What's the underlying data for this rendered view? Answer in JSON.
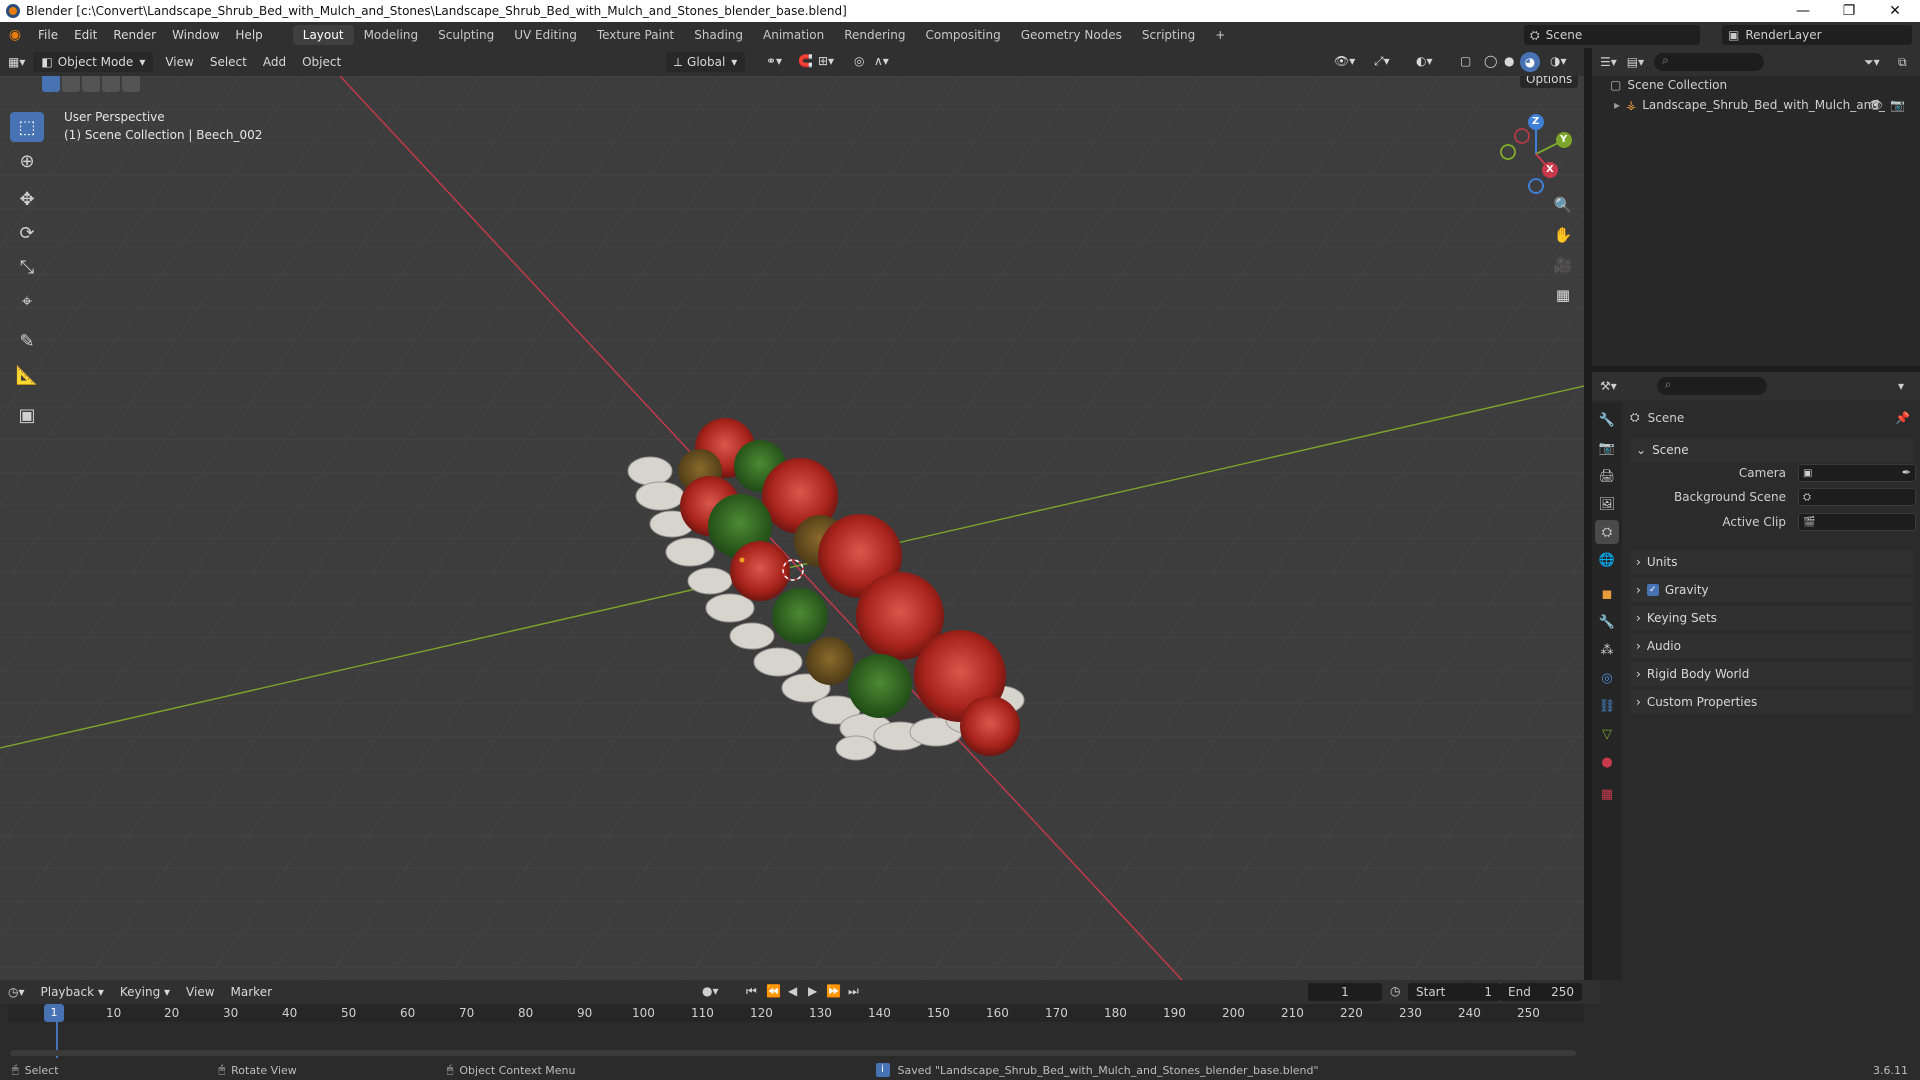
{
  "window": {
    "title": "Blender [c:\\Convert\\Landscape_Shrub_Bed_with_Mulch_and_Stones\\Landscape_Shrub_Bed_with_Mulch_and_Stones_blender_base.blend]",
    "minimize": "—",
    "maximize": "❐",
    "close": "✕"
  },
  "menu": {
    "items": [
      "File",
      "Edit",
      "Render",
      "Window",
      "Help"
    ],
    "workspaces": [
      "Layout",
      "Modeling",
      "Sculpting",
      "UV Editing",
      "Texture Paint",
      "Shading",
      "Animation",
      "Rendering",
      "Compositing",
      "Geometry Nodes",
      "Scripting"
    ],
    "add_tab": "+",
    "scene_name": "Scene",
    "render_layer": "RenderLayer"
  },
  "viewport_header": {
    "mode": "Object Mode",
    "menus": [
      "View",
      "Select",
      "Add",
      "Object"
    ],
    "transform_orientation": "Global",
    "options_label": "Options"
  },
  "viewport": {
    "perspective_label": "User Perspective",
    "collection_label": "(1) Scene Collection | Beech_002",
    "gizmo_axes": {
      "x": "X",
      "y": "Y",
      "z": "Z"
    }
  },
  "outliner": {
    "root": "Scene Collection",
    "object": "Landscape_Shrub_Bed_with_Mulch_and_"
  },
  "properties": {
    "header": "Scene",
    "section": "Scene",
    "fields": {
      "camera_label": "Camera",
      "background_scene_label": "Background Scene",
      "active_clip_label": "Active Clip"
    },
    "panels": [
      "Units",
      "Gravity",
      "Keying Sets",
      "Audio",
      "Rigid Body World",
      "Custom Properties"
    ],
    "gravity_checked": true
  },
  "timeline": {
    "menus": [
      "Playback",
      "Keying",
      "View",
      "Marker"
    ],
    "current_frame": "1",
    "start_label": "Start",
    "start_value": "1",
    "end_label": "End",
    "end_value": "250",
    "ruler": [
      "1",
      "10",
      "20",
      "30",
      "40",
      "50",
      "60",
      "70",
      "80",
      "90",
      "100",
      "110",
      "120",
      "130",
      "140",
      "150",
      "160",
      "170",
      "180",
      "190",
      "200",
      "210",
      "220",
      "230",
      "240",
      "250"
    ]
  },
  "statusbar": {
    "select": "Select",
    "rotate": "Rotate View",
    "context_menu": "Object Context Menu",
    "message": "Saved \"Landscape_Shrub_Bed_with_Mulch_and_Stones_blender_base.blend\"",
    "version": "3.6.11"
  },
  "colors": {
    "accent": "#4772b3",
    "x_axis": "#c8394b",
    "y_axis": "#7ca52b",
    "z_axis": "#3f7fd6"
  }
}
